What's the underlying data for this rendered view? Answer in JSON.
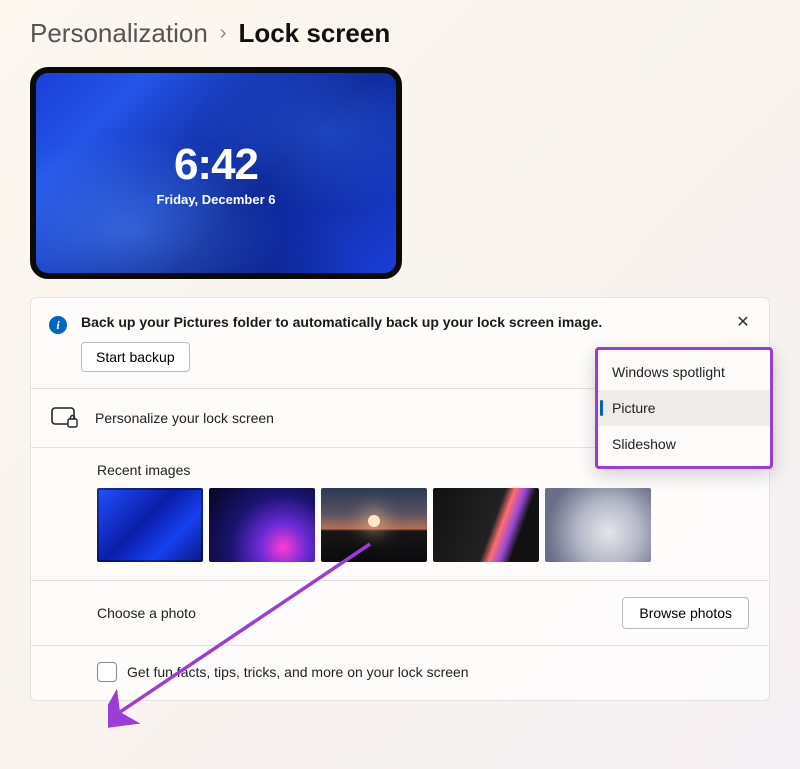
{
  "breadcrumb": {
    "parent": "Personalization",
    "separator": "›",
    "current": "Lock screen"
  },
  "preview": {
    "time": "6:42",
    "date": "Friday, December 6"
  },
  "banner": {
    "text": "Back up your Pictures folder to automatically back up your lock screen image.",
    "button": "Start backup"
  },
  "personalize": {
    "label": "Personalize your lock screen"
  },
  "dropdown": {
    "options": [
      "Windows spotlight",
      "Picture",
      "Slideshow"
    ],
    "selected_index": 1
  },
  "recent": {
    "title": "Recent images"
  },
  "choose": {
    "label": "Choose a photo",
    "button": "Browse photos"
  },
  "funfacts": {
    "label": "Get fun facts, tips, tricks, and more on your lock screen",
    "checked": false
  },
  "annotation": {
    "color": "#9a3dd8"
  }
}
